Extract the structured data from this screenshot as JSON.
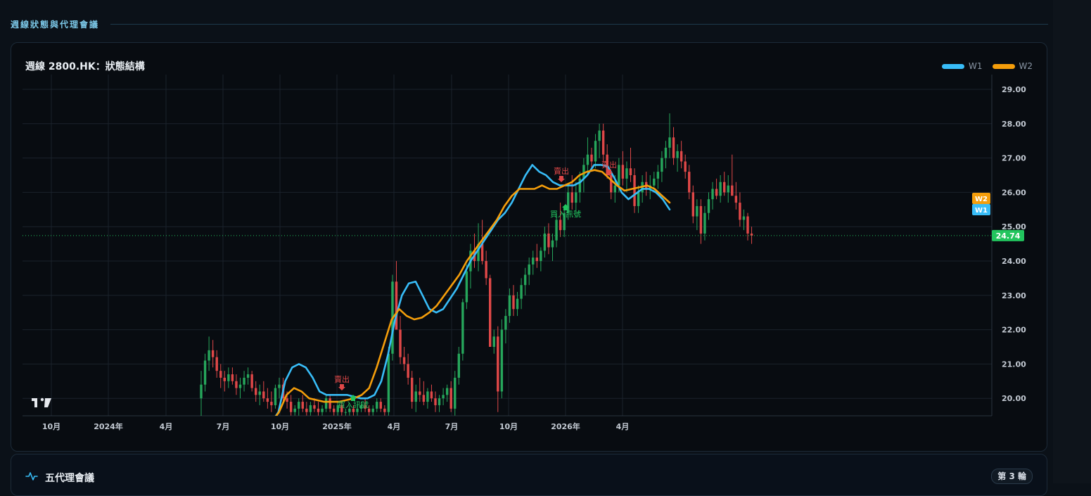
{
  "section": {
    "title": "週線狀態與代理會議"
  },
  "chart": {
    "title": "週線 2800.HK：狀態結構",
    "legend": [
      {
        "name": "W1",
        "color": "#38bdf8"
      },
      {
        "name": "W2",
        "color": "#f59e0b"
      }
    ],
    "last_price_label": "24.74"
  },
  "chart_data": {
    "type": "candlestick",
    "title": "週線 2800.HK：狀態結構",
    "y_ticks": [
      "29.00",
      "28.00",
      "27.00",
      "26.00",
      "25.00",
      "24.00",
      "23.00",
      "22.00",
      "21.00",
      "20.00"
    ],
    "x_ticks": [
      "10月",
      "2024年",
      "4月",
      "7月",
      "10月",
      "2025年",
      "4月",
      "7月",
      "10月",
      "2026年",
      "4月"
    ],
    "ylim": [
      19.5,
      29.2
    ],
    "last_price": 24.74,
    "colors": {
      "up": "#26a65b",
      "down": "#e04848",
      "w1": "#38bdf8",
      "w2": "#f59e0b",
      "last": "#22c55e"
    },
    "candles": [
      [
        20.0,
        20.8,
        19.4,
        20.4
      ],
      [
        20.4,
        21.3,
        20.2,
        21.1
      ],
      [
        21.1,
        21.8,
        20.8,
        21.4
      ],
      [
        21.4,
        21.7,
        20.9,
        21.2
      ],
      [
        21.2,
        21.4,
        20.6,
        20.8
      ],
      [
        20.8,
        21.0,
        20.3,
        20.6
      ],
      [
        20.6,
        20.8,
        20.2,
        20.5
      ],
      [
        20.5,
        20.9,
        20.3,
        20.7
      ],
      [
        20.7,
        20.9,
        20.4,
        20.5
      ],
      [
        20.5,
        20.7,
        20.1,
        20.3
      ],
      [
        20.3,
        20.6,
        20.0,
        20.4
      ],
      [
        20.4,
        20.8,
        20.2,
        20.6
      ],
      [
        20.6,
        20.9,
        20.4,
        20.7
      ],
      [
        20.7,
        20.8,
        20.2,
        20.3
      ],
      [
        20.3,
        20.5,
        19.9,
        20.1
      ],
      [
        20.1,
        20.4,
        19.8,
        20.2
      ],
      [
        20.2,
        20.5,
        19.9,
        20.0
      ],
      [
        20.0,
        20.3,
        19.7,
        19.9
      ],
      [
        19.9,
        20.2,
        19.6,
        19.8
      ],
      [
        19.8,
        20.4,
        19.7,
        20.3
      ],
      [
        20.3,
        20.6,
        20.0,
        20.4
      ],
      [
        20.4,
        20.6,
        19.9,
        20.0
      ],
      [
        20.0,
        20.2,
        19.7,
        19.9
      ],
      [
        19.9,
        20.1,
        19.5,
        19.6
      ],
      [
        19.6,
        19.8,
        19.5,
        19.7
      ],
      [
        19.7,
        20.0,
        19.5,
        19.9
      ],
      [
        19.9,
        20.1,
        19.6,
        19.7
      ],
      [
        19.7,
        19.9,
        19.5,
        19.6
      ],
      [
        19.6,
        19.9,
        19.5,
        19.8
      ],
      [
        19.8,
        20.0,
        19.6,
        19.7
      ],
      [
        19.7,
        19.9,
        19.5,
        19.6
      ],
      [
        19.6,
        19.8,
        19.5,
        19.7
      ],
      [
        19.7,
        20.1,
        19.6,
        20.0
      ],
      [
        20.0,
        20.1,
        19.6,
        19.7
      ],
      [
        19.7,
        19.8,
        19.5,
        19.6
      ],
      [
        19.6,
        19.9,
        19.5,
        19.8
      ],
      [
        19.8,
        19.9,
        19.5,
        19.6
      ],
      [
        19.6,
        19.7,
        19.5,
        19.6
      ],
      [
        19.6,
        19.8,
        19.5,
        19.7
      ],
      [
        19.7,
        19.8,
        19.5,
        19.6
      ],
      [
        19.6,
        19.8,
        19.5,
        19.7
      ],
      [
        19.7,
        19.9,
        19.6,
        19.8
      ],
      [
        19.8,
        20.0,
        19.6,
        19.7
      ],
      [
        19.7,
        19.8,
        19.5,
        19.6
      ],
      [
        19.6,
        19.8,
        19.5,
        19.7
      ],
      [
        19.7,
        20.0,
        19.6,
        19.9
      ],
      [
        19.9,
        20.0,
        19.6,
        19.7
      ],
      [
        19.7,
        19.8,
        19.5,
        19.6
      ],
      [
        19.6,
        21.5,
        19.5,
        21.3
      ],
      [
        21.3,
        23.6,
        21.1,
        23.4
      ],
      [
        23.4,
        24.0,
        22.5,
        22.0
      ],
      [
        22.0,
        22.4,
        21.0,
        21.2
      ],
      [
        21.2,
        21.5,
        20.8,
        21.0
      ],
      [
        21.0,
        21.3,
        20.4,
        20.6
      ],
      [
        20.6,
        20.8,
        19.7,
        19.9
      ],
      [
        19.9,
        20.4,
        19.6,
        20.2
      ],
      [
        20.2,
        20.6,
        19.9,
        20.1
      ],
      [
        20.1,
        20.5,
        19.8,
        19.9
      ],
      [
        19.9,
        20.3,
        19.7,
        20.2
      ],
      [
        20.2,
        20.4,
        19.9,
        20.0
      ],
      [
        20.0,
        20.2,
        19.6,
        19.8
      ],
      [
        19.8,
        20.1,
        19.6,
        20.0
      ],
      [
        20.0,
        20.3,
        19.8,
        20.1
      ],
      [
        20.1,
        20.4,
        19.9,
        20.3
      ],
      [
        20.3,
        20.5,
        19.6,
        19.7
      ],
      [
        19.7,
        20.8,
        19.5,
        20.6
      ],
      [
        20.6,
        21.5,
        20.4,
        21.3
      ],
      [
        21.3,
        22.9,
        21.1,
        22.8
      ],
      [
        22.8,
        23.9,
        22.6,
        23.7
      ],
      [
        23.7,
        24.5,
        23.2,
        24.3
      ],
      [
        24.3,
        24.8,
        23.8,
        24.0
      ],
      [
        24.0,
        25.1,
        23.7,
        24.5
      ],
      [
        24.5,
        25.2,
        23.9,
        24.0
      ],
      [
        24.0,
        24.3,
        23.3,
        23.5
      ],
      [
        23.5,
        23.6,
        21.5,
        21.5
      ],
      [
        21.5,
        22.0,
        21.3,
        21.8
      ],
      [
        21.8,
        22.1,
        19.6,
        20.2
      ],
      [
        20.2,
        22.3,
        20.0,
        22.0
      ],
      [
        22.0,
        22.6,
        21.6,
        22.4
      ],
      [
        22.4,
        23.2,
        22.2,
        23.0
      ],
      [
        23.0,
        23.3,
        22.4,
        22.6
      ],
      [
        22.6,
        23.1,
        22.4,
        22.9
      ],
      [
        22.9,
        23.5,
        22.6,
        23.3
      ],
      [
        23.3,
        23.8,
        23.0,
        23.6
      ],
      [
        23.6,
        24.1,
        23.3,
        23.9
      ],
      [
        23.9,
        24.3,
        23.6,
        24.1
      ],
      [
        24.1,
        24.5,
        23.8,
        24.0
      ],
      [
        24.0,
        24.4,
        23.7,
        24.3
      ],
      [
        24.3,
        25.0,
        24.1,
        24.8
      ],
      [
        24.8,
        25.1,
        24.2,
        24.4
      ],
      [
        24.4,
        24.8,
        24.0,
        24.6
      ],
      [
        24.6,
        25.4,
        24.4,
        25.2
      ],
      [
        25.2,
        25.7,
        24.7,
        24.9
      ],
      [
        24.9,
        25.6,
        24.7,
        25.4
      ],
      [
        25.4,
        26.2,
        25.2,
        26.0
      ],
      [
        26.0,
        26.5,
        25.5,
        25.7
      ],
      [
        25.7,
        26.3,
        25.4,
        26.0
      ],
      [
        26.0,
        26.6,
        25.7,
        26.4
      ],
      [
        26.4,
        27.0,
        26.0,
        26.8
      ],
      [
        26.8,
        27.6,
        26.5,
        27.1
      ],
      [
        27.1,
        27.3,
        26.6,
        26.9
      ],
      [
        26.9,
        27.7,
        26.7,
        27.5
      ],
      [
        27.5,
        28.0,
        27.0,
        27.8
      ],
      [
        27.8,
        28.0,
        26.9,
        27.1
      ],
      [
        27.1,
        27.4,
        26.4,
        26.5
      ],
      [
        26.5,
        26.6,
        25.8,
        26.0
      ],
      [
        26.0,
        26.5,
        25.7,
        26.2
      ],
      [
        26.2,
        27.0,
        26.0,
        26.8
      ],
      [
        26.8,
        27.2,
        26.2,
        26.4
      ],
      [
        26.4,
        26.9,
        26.0,
        26.7
      ],
      [
        26.7,
        27.3,
        26.3,
        26.5
      ],
      [
        26.5,
        26.7,
        25.4,
        25.6
      ],
      [
        25.6,
        26.2,
        25.4,
        26.0
      ],
      [
        26.0,
        26.5,
        25.7,
        26.3
      ],
      [
        26.3,
        26.6,
        25.9,
        26.1
      ],
      [
        26.1,
        26.5,
        25.8,
        26.2
      ],
      [
        26.2,
        26.6,
        26.0,
        26.4
      ],
      [
        26.4,
        26.8,
        26.1,
        26.6
      ],
      [
        26.6,
        27.2,
        26.3,
        27.0
      ],
      [
        27.0,
        27.5,
        26.7,
        27.3
      ],
      [
        27.3,
        28.3,
        27.0,
        27.6
      ],
      [
        27.6,
        27.9,
        26.8,
        27.0
      ],
      [
        27.0,
        27.4,
        26.6,
        27.2
      ],
      [
        27.2,
        27.5,
        26.7,
        26.9
      ],
      [
        26.9,
        27.1,
        26.4,
        26.6
      ],
      [
        26.6,
        26.8,
        25.8,
        26.0
      ],
      [
        26.0,
        26.2,
        25.1,
        25.3
      ],
      [
        25.3,
        25.8,
        24.9,
        25.6
      ],
      [
        25.6,
        25.8,
        24.5,
        24.8
      ],
      [
        24.8,
        25.6,
        24.6,
        25.4
      ],
      [
        25.4,
        26.0,
        25.2,
        25.8
      ],
      [
        25.8,
        26.3,
        25.5,
        26.1
      ],
      [
        26.1,
        26.4,
        25.8,
        25.9
      ],
      [
        25.9,
        26.5,
        25.7,
        26.3
      ],
      [
        26.3,
        26.6,
        25.9,
        26.0
      ],
      [
        26.0,
        26.5,
        25.7,
        26.2
      ],
      [
        26.2,
        27.1,
        26.0,
        25.9
      ],
      [
        25.9,
        26.3,
        25.5,
        25.7
      ],
      [
        25.7,
        26.0,
        25.0,
        25.2
      ],
      [
        25.2,
        25.5,
        24.9,
        25.3
      ],
      [
        25.3,
        25.4,
        24.6,
        24.8
      ],
      [
        24.8,
        25.0,
        24.5,
        24.74
      ]
    ],
    "series": [
      {
        "name": "W1",
        "color": "#38bdf8",
        "values": [
          19.3,
          19.6,
          20.5,
          20.9,
          21.0,
          20.9,
          20.6,
          20.2,
          20.1,
          20.1,
          20.1,
          20.1,
          20.05,
          20.0,
          20.0,
          20.1,
          20.5,
          21.3,
          22.3,
          23.0,
          23.35,
          23.4,
          23.0,
          22.6,
          22.5,
          22.6,
          22.9,
          23.2,
          23.6,
          24.0,
          24.3,
          24.6,
          24.9,
          25.2,
          25.4,
          25.7,
          26.1,
          26.5,
          26.8,
          26.6,
          26.5,
          26.3,
          26.2,
          26.2,
          26.2,
          26.3,
          26.5,
          26.8,
          26.8,
          26.75,
          26.4,
          26.0,
          25.8,
          25.95,
          26.1,
          26.1,
          26.0,
          25.8,
          25.5
        ]
      },
      {
        "name": "W2",
        "color": "#f59e0b",
        "values": [
          19.3,
          19.6,
          20.1,
          20.3,
          20.2,
          20.0,
          19.95,
          19.9,
          19.9,
          19.9,
          19.95,
          20.0,
          20.1,
          20.3,
          20.9,
          21.6,
          22.3,
          22.6,
          22.4,
          22.3,
          22.35,
          22.5,
          22.7,
          23.0,
          23.3,
          23.6,
          24.0,
          24.3,
          24.6,
          24.9,
          25.2,
          25.6,
          25.9,
          26.1,
          26.1,
          26.1,
          26.2,
          26.1,
          26.1,
          26.2,
          26.3,
          26.5,
          26.6,
          26.65,
          26.6,
          26.4,
          26.2,
          26.05,
          26.1,
          26.15,
          26.2,
          26.1,
          25.9,
          25.7
        ]
      }
    ],
    "signals": [
      {
        "type": "sell",
        "label": "賣出"
      },
      {
        "type": "buy",
        "label": "買入訊號"
      },
      {
        "type": "sell",
        "label": "賣出"
      },
      {
        "type": "buy",
        "label": "買入訊號"
      },
      {
        "type": "sell",
        "label": "賣出"
      }
    ],
    "series_labels": [
      "W2",
      "W1"
    ]
  },
  "agents": {
    "title": "五代理會議",
    "round_badge": "第 3 輪"
  }
}
